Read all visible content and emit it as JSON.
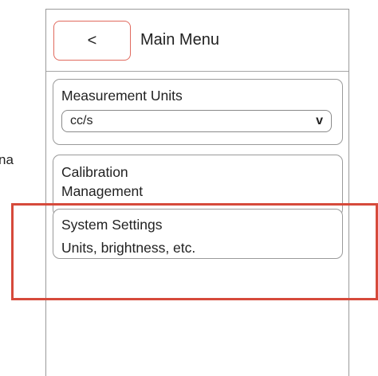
{
  "edge_text": "na",
  "header": {
    "back_label": "<",
    "title": "Main Menu"
  },
  "measurement_units": {
    "label": "Measurement Units",
    "selected": "cc/s",
    "dropdown_glyph": "v"
  },
  "calibration": {
    "line1": "Calibration",
    "line2": "Management"
  },
  "system_settings": {
    "title": "System Settings",
    "subtitle": "Units, brightness, etc."
  },
  "colors": {
    "highlight": "#d64a3b",
    "back_button_border": "#e06a5e",
    "border": "#9a9a9a"
  }
}
